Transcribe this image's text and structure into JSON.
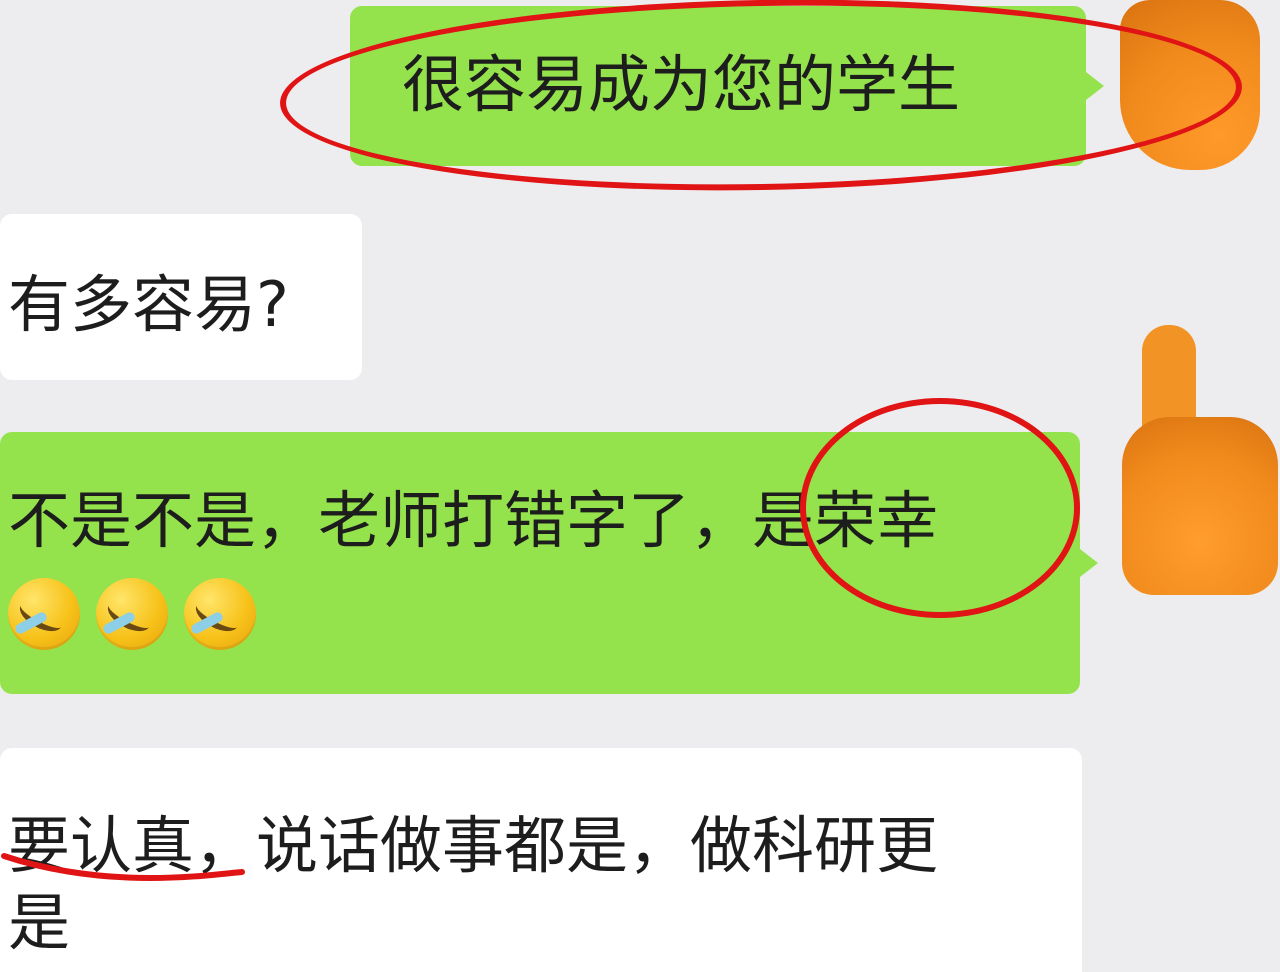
{
  "messages": [
    {
      "direction": "sent",
      "text": "很容易成为您的学生"
    },
    {
      "direction": "received",
      "text": "有多容易?"
    },
    {
      "direction": "sent",
      "text": "不是不是，老师打错字了，是荣幸",
      "emoji": [
        "crying-laughing-emoji",
        "crying-laughing-emoji",
        "crying-laughing-emoji"
      ]
    },
    {
      "direction": "received",
      "lines": [
        "要认真，说话做事都是，做科研更",
        "是"
      ]
    }
  ],
  "colors": {
    "sent_bubble": "#95e34c",
    "received_bubble": "#ffffff",
    "background": "#ededf0",
    "annotation": "#e01414",
    "avatar": "#f08a1c"
  }
}
